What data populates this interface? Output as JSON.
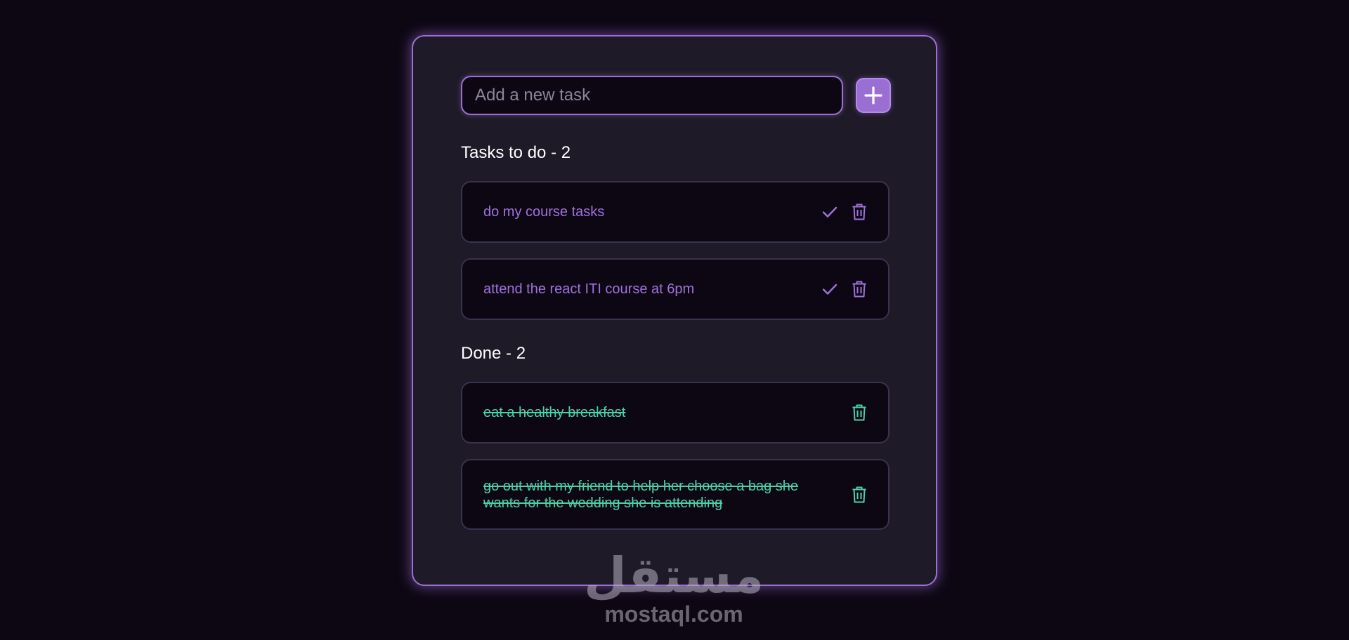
{
  "input": {
    "placeholder": "Add a new task",
    "value": ""
  },
  "add_button": {
    "icon": "plus-icon"
  },
  "todo": {
    "title": "Tasks to do - 2",
    "items": [
      {
        "text": "do my course tasks"
      },
      {
        "text": "attend the react ITI course at 6pm"
      }
    ]
  },
  "done": {
    "title": "Done - 2",
    "items": [
      {
        "text": "eat a healthy breakfast"
      },
      {
        "text": "go out with my friend to help her choose a bag she wants for the wedding she is attending"
      }
    ]
  },
  "watermark": {
    "logo": "مستقل",
    "text": "mostaql.com"
  },
  "colors": {
    "page_background": "#0d0714",
    "card_background": "#1e1a27",
    "accent": "#9d6fd6",
    "todo_text": "#9f72dc",
    "done_text": "#4ed1a6"
  },
  "icons": {
    "complete": "check-icon",
    "delete": "trash-icon"
  }
}
